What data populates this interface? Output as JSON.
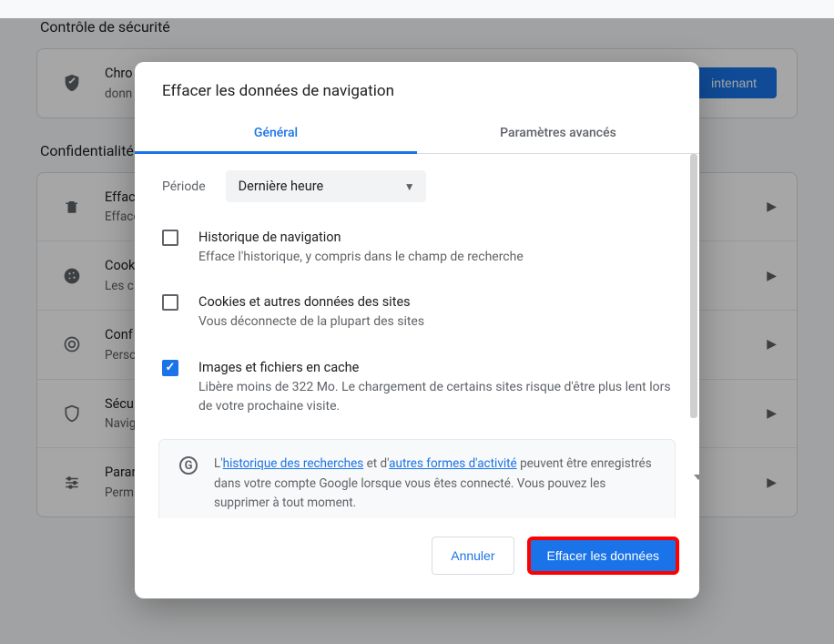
{
  "bg": {
    "safety_title": "Contrôle de sécurité",
    "safety_row": {
      "title": "Chro",
      "sub": "donn",
      "btn": "intenant"
    },
    "privacy_title": "Confidentialité",
    "rows": [
      {
        "title": "Effacer",
        "sub": "Effacer"
      },
      {
        "title": "Cook",
        "sub": "Les c"
      },
      {
        "title": "Conf",
        "sub": "Perso"
      },
      {
        "title": "Sécu",
        "sub": "Navig"
      },
      {
        "title": "Paran",
        "sub": "Perm et contrôles (emplacement, caméra, fenêtres pop-up et plus)"
      }
    ]
  },
  "dialog": {
    "title": "Effacer les données de navigation",
    "tabs": {
      "general": "Général",
      "advanced": "Paramètres avancés"
    },
    "period_label": "Période",
    "period_value": "Dernière heure",
    "options": [
      {
        "checked": false,
        "title": "Historique de navigation",
        "sub": "Efface l'historique, y compris dans le champ de recherche"
      },
      {
        "checked": false,
        "title": "Cookies et autres données des sites",
        "sub": "Vous déconnecte de la plupart des sites"
      },
      {
        "checked": true,
        "title": "Images et fichiers en cache",
        "sub": "Libère moins de 322 Mo. Le chargement de certains sites risque d'être plus lent lors de votre prochaine visite."
      }
    ],
    "info": {
      "g_logo": "G",
      "prefix": "L'",
      "link1": "historique des recherches",
      "mid1": " et d'",
      "link2": "autres formes d'activité",
      "suffix": " peuvent être enregistrés dans votre compte Google lorsque vous êtes connecté. Vous pouvez les supprimer à tout moment."
    },
    "buttons": {
      "cancel": "Annuler",
      "clear": "Effacer les données"
    }
  }
}
